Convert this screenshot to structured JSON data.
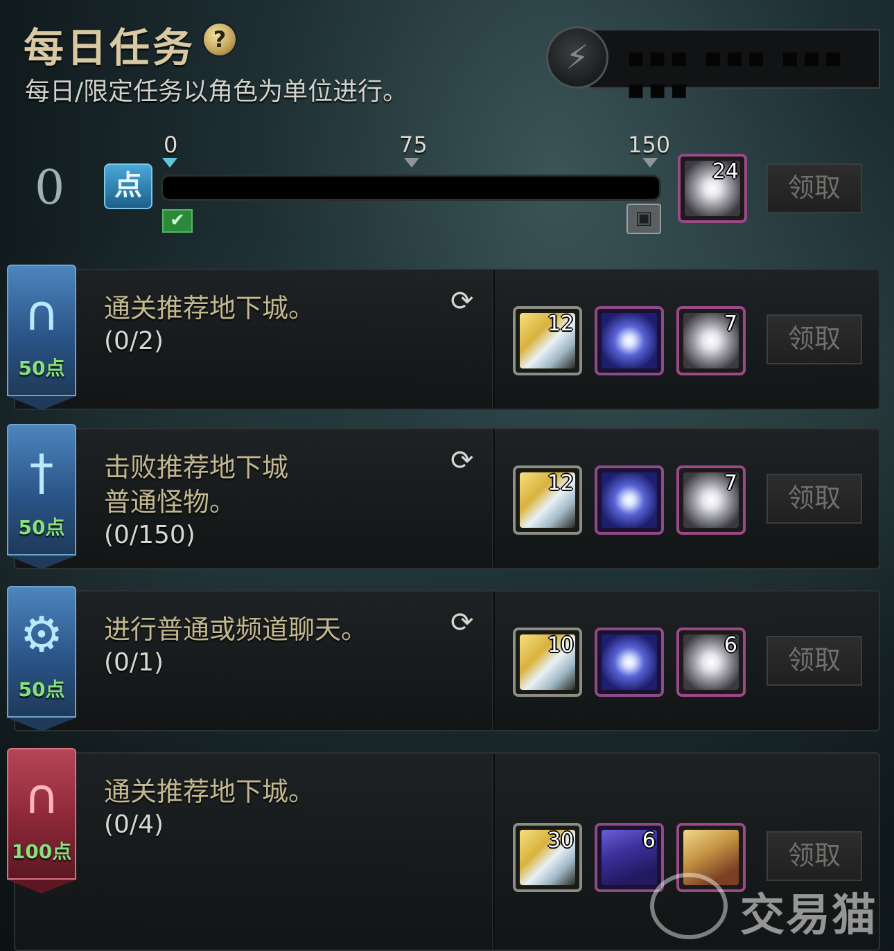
{
  "header": {
    "title": "每日任务",
    "help_icon": "question-mark-icon",
    "help_label": "?",
    "subtitle": "每日/限定任务以角色为单位进行。",
    "energy_icon": "lightning-icon",
    "energy_text": "▪▪▪ ▪▪▪ ▪▪▪ ▪▪▪"
  },
  "points": {
    "current": "0",
    "icon_label": "点",
    "progress": 0,
    "max": 150,
    "ticks": [
      "0",
      "75",
      "150"
    ],
    "bonus_item_count": "24",
    "claim_label": "领取"
  },
  "quests": [
    {
      "text": "通关推荐地下城。",
      "progress": "(0/2)",
      "points": "50点",
      "banner_color": "blue",
      "icon": "dungeon-gate-icon",
      "rewards": [
        {
          "type": "gold-crystal",
          "count": "12"
        },
        {
          "type": "blue-orb",
          "count": ""
        },
        {
          "type": "mist-orb",
          "count": "7"
        }
      ],
      "claim_label": "领取"
    },
    {
      "text": "击败推荐地下城\n普通怪物。",
      "progress": "(0/150)",
      "points": "50点",
      "banner_color": "blue",
      "icon": "sword-icon",
      "rewards": [
        {
          "type": "gold-crystal",
          "count": "12"
        },
        {
          "type": "blue-orb",
          "count": ""
        },
        {
          "type": "mist-orb",
          "count": "7"
        }
      ],
      "claim_label": "领取"
    },
    {
      "text": "进行普通或频道聊天。",
      "progress": "(0/1)",
      "points": "50点",
      "banner_color": "blue",
      "icon": "gear-icon",
      "rewards": [
        {
          "type": "gold-crystal",
          "count": "10"
        },
        {
          "type": "blue-orb",
          "count": ""
        },
        {
          "type": "mist-orb",
          "count": "6"
        }
      ],
      "claim_label": "领取"
    },
    {
      "text": "通关推荐地下城。",
      "progress": "(0/4)",
      "points": "100点",
      "banner_color": "red",
      "icon": "dungeon-gate-icon",
      "rewards": [
        {
          "type": "gold-crystal",
          "count": "30"
        },
        {
          "type": "books",
          "count": "6"
        },
        {
          "type": "scroll",
          "count": ""
        }
      ],
      "claim_label": "领取"
    }
  ],
  "watermark": {
    "text": "交易猫",
    "icon": "cat-logo-icon"
  },
  "colors": {
    "accent_cyan": "#5fc6e0",
    "points_green": "#86e07c",
    "quest_text": "#c2b88f",
    "banner_blue": "#2b5488",
    "banner_red": "#8b2737"
  }
}
